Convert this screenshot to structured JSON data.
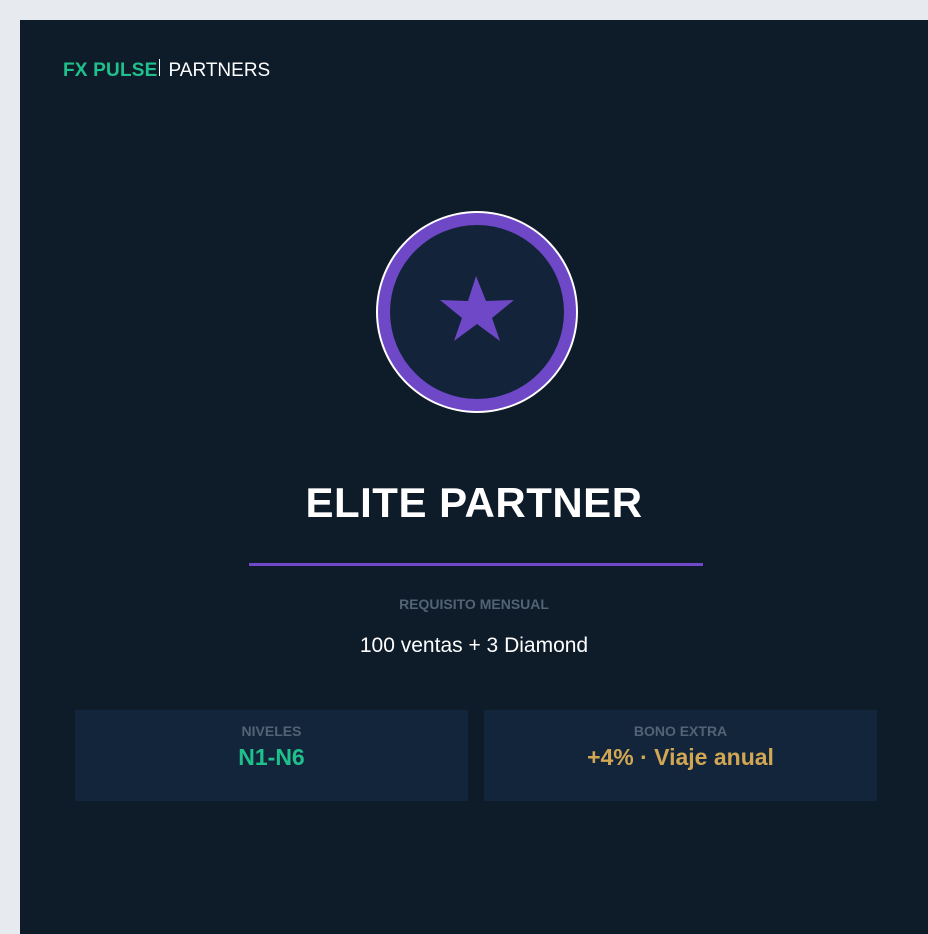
{
  "brand": {
    "name": "FX PULSE",
    "section": "PARTNERS"
  },
  "badge": {
    "icon": "star-icon",
    "ring_color": "#6f48c7",
    "inner_color": "#13243a"
  },
  "tier": {
    "title": "ELITE PARTNER",
    "requirement_label": "REQUISITO MENSUAL",
    "requirement_value": "100 ventas + 3 Diamond"
  },
  "stats": [
    {
      "label": "NIVELES",
      "value": "N1-N6",
      "color": "#1fc08c"
    },
    {
      "label": "BONO EXTRA",
      "value": "+4% · Viaje anual",
      "color": "#d1a754"
    }
  ],
  "colors": {
    "background": "#0e1b29",
    "panel": "#13253a",
    "accent": "#7048c9",
    "brand": "#1fc08c"
  }
}
